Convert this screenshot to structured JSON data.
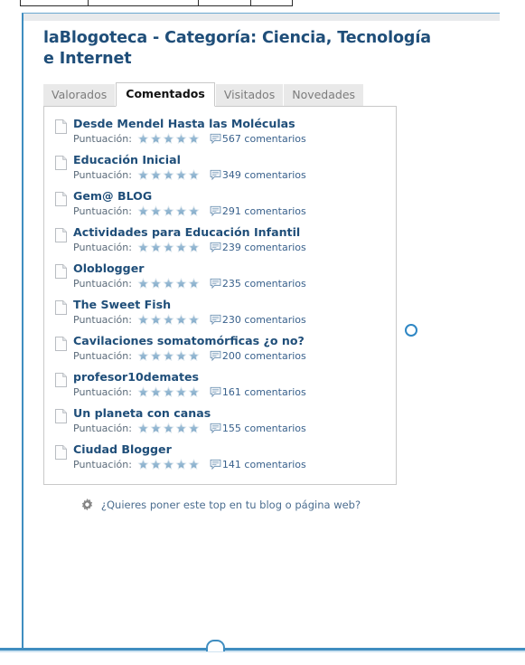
{
  "top_toolbar": {
    "present": true,
    "black_indicator": "selected-cell-marker"
  },
  "widget": {
    "title": "laBlogoteca - Categoría: Ciencia, Tecnología e Internet",
    "accent_color": "#3f8dc0",
    "title_color": "#1f4e79",
    "star_color": "#8fb4d0",
    "tabs": [
      {
        "label": "Valorados",
        "active": false
      },
      {
        "label": "Comentados",
        "active": true
      },
      {
        "label": "Visitados",
        "active": false
      },
      {
        "label": "Novedades",
        "active": false
      }
    ],
    "score_label": "Puntuación:",
    "comments_word": "comentarios",
    "items": [
      {
        "title": "Desde Mendel Hasta las Moléculas",
        "stars": 5,
        "comments": "567",
        "comments_text": "567 comentarios"
      },
      {
        "title": "Educación Inicial",
        "stars": 5,
        "comments": "349",
        "comments_text": "349 comentarios"
      },
      {
        "title": "Gem@ BLOG",
        "stars": 5,
        "comments": "291",
        "comments_text": "291 comentarios"
      },
      {
        "title": "Actividades para Educación Infantil",
        "stars": 5,
        "comments": "239",
        "comments_text": "239 comentarios"
      },
      {
        "title": "Oloblogger",
        "stars": 5,
        "comments": "235",
        "comments_text": "235 comentarios"
      },
      {
        "title": "The Sweet Fish",
        "stars": 5,
        "comments": "230",
        "comments_text": "230 comentarios"
      },
      {
        "title": "Cavilaciones somatomórficas ¿o no?",
        "stars": 5,
        "comments": "200",
        "comments_text": "200 comentarios"
      },
      {
        "title": "profesor10demates",
        "stars": 5,
        "comments": "161",
        "comments_text": "161 comentarios"
      },
      {
        "title": "Un planeta con canas",
        "stars": 5,
        "comments": "155",
        "comments_text": "155 comentarios"
      },
      {
        "title": "Ciudad Blogger",
        "stars": 5,
        "comments": "141",
        "comments_text": "141 comentarios"
      }
    ],
    "footer": {
      "icon": "gear-icon",
      "text": "¿Quieres poner este top en tu blog o página web?"
    }
  }
}
